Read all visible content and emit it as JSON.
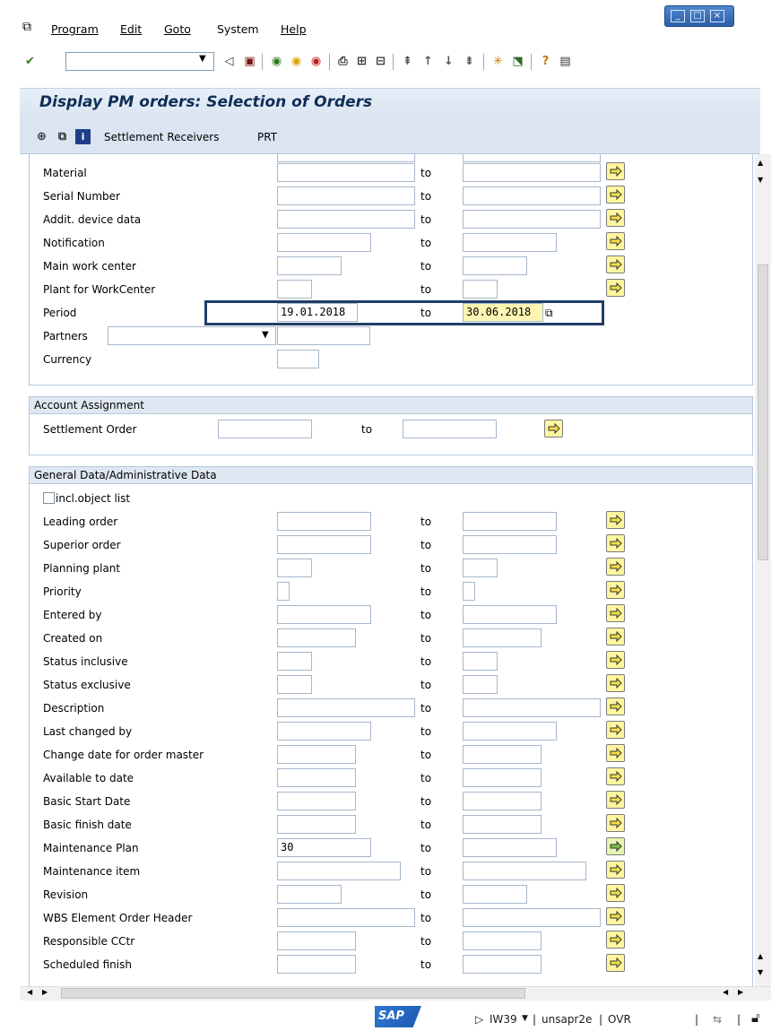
{
  "menu": {
    "items": [
      "Program",
      "Edit",
      "Goto",
      "System",
      "Help"
    ]
  },
  "toolbar": {
    "command_value": ""
  },
  "page": {
    "title": "Display PM orders: Selection of Orders"
  },
  "app_toolbar": {
    "settlement_receivers": "Settlement Receivers",
    "prt": "PRT"
  },
  "common": {
    "to": "to"
  },
  "section1": {
    "rows": [
      {
        "label": "Material",
        "from": "",
        "to": ""
      },
      {
        "label": "Serial Number",
        "from": "",
        "to": ""
      },
      {
        "label": "Addit. device data",
        "from": "",
        "to": ""
      },
      {
        "label": "Notification",
        "from": "",
        "to": ""
      },
      {
        "label": "Main work center",
        "from": "",
        "to": ""
      },
      {
        "label": "Plant for WorkCenter",
        "from": "",
        "to": ""
      },
      {
        "label": "Period",
        "from": "19.01.2018",
        "to": "30.06.2018"
      }
    ],
    "partners": {
      "label": "Partners",
      "value": ""
    },
    "currency": {
      "label": "Currency",
      "value": ""
    }
  },
  "account_assignment": {
    "title": "Account Assignment",
    "settlement_order": {
      "label": "Settlement Order",
      "from": "",
      "to": ""
    }
  },
  "general_data": {
    "title": "General Data/Administrative Data",
    "incl_object_list": {
      "label": "incl.object list",
      "checked": false
    },
    "rows": [
      {
        "label": "Leading order",
        "from": "",
        "to": ""
      },
      {
        "label": "Superior order",
        "from": "",
        "to": ""
      },
      {
        "label": "Planning plant",
        "from": "",
        "to": ""
      },
      {
        "label": "Priority",
        "from": "",
        "to": ""
      },
      {
        "label": "Entered by",
        "from": "",
        "to": ""
      },
      {
        "label": "Created on",
        "from": "",
        "to": ""
      },
      {
        "label": "Status inclusive",
        "from": "",
        "to": ""
      },
      {
        "label": "Status exclusive",
        "from": "",
        "to": ""
      },
      {
        "label": "Description",
        "from": "",
        "to": ""
      },
      {
        "label": "Last changed by",
        "from": "",
        "to": ""
      },
      {
        "label": "Change date for order master",
        "from": "",
        "to": ""
      },
      {
        "label": "Available to date",
        "from": "",
        "to": ""
      },
      {
        "label": "Basic Start Date",
        "from": "",
        "to": ""
      },
      {
        "label": "Basic finish date",
        "from": "",
        "to": ""
      },
      {
        "label": "Maintenance Plan",
        "from": "30",
        "to": ""
      },
      {
        "label": "Maintenance item",
        "from": "",
        "to": ""
      },
      {
        "label": "Revision",
        "from": "",
        "to": ""
      },
      {
        "label": "WBS Element Order Header",
        "from": "",
        "to": ""
      },
      {
        "label": "Responsible CCtr",
        "from": "",
        "to": ""
      },
      {
        "label": "Scheduled finish",
        "from": "",
        "to": ""
      }
    ]
  },
  "status": {
    "transaction": "IW39",
    "system": "unsapr2e",
    "mode": "OVR",
    "logo": "SAP"
  },
  "colors": {
    "title": "#0f2e57",
    "header_bg": "#dbe5f1",
    "arrow_button": "#fff6a0",
    "highlight": "#1f3e67"
  }
}
